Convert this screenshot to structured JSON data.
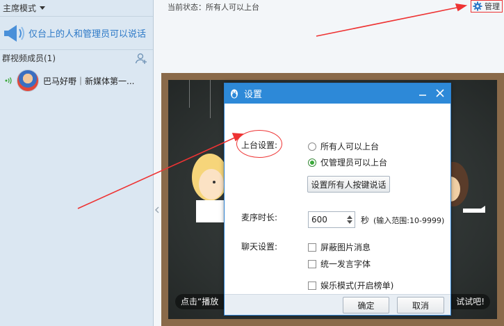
{
  "left_panel": {
    "mode_label": "主席模式",
    "notice_text": "仅台上的人和管理员可以说话",
    "members_header": "群视频成员(1)",
    "member": {
      "name": "巴马好嘢｜新媒体第一..."
    }
  },
  "right_panel": {
    "status_text": "当前状态：所有人可以上台",
    "manage_label": "管理",
    "stage_caption_left": "点击“播放",
    "stage_caption_right": "试试吧!"
  },
  "dialog": {
    "title": "设置",
    "stage_setting_label": "上台设置:",
    "radio_all": "所有人可以上台",
    "radio_admin_only": "仅管理员可以上台",
    "radio_selected": "admin_only",
    "set_key_button": "设置所有人按键说话",
    "mic_time_label": "麦序时长:",
    "mic_time_value": "600",
    "mic_time_unit": "秒",
    "mic_time_range": "(输入范围:10-9999)",
    "chat_setting_label": "聊天设置:",
    "check_block_images": "屏蔽图片消息",
    "check_unify_font": "统一发言字体",
    "check_entertainment": "娱乐模式(开启榜单)",
    "ok_button": "确定",
    "cancel_button": "取消"
  },
  "colors": {
    "dialog_title_bar": "#2d89d8",
    "annotation_red": "#ee3333",
    "left_panel_bg": "#dbe7f2",
    "notice_text": "#2d79c7",
    "radio_selected": "#3aa83a"
  }
}
